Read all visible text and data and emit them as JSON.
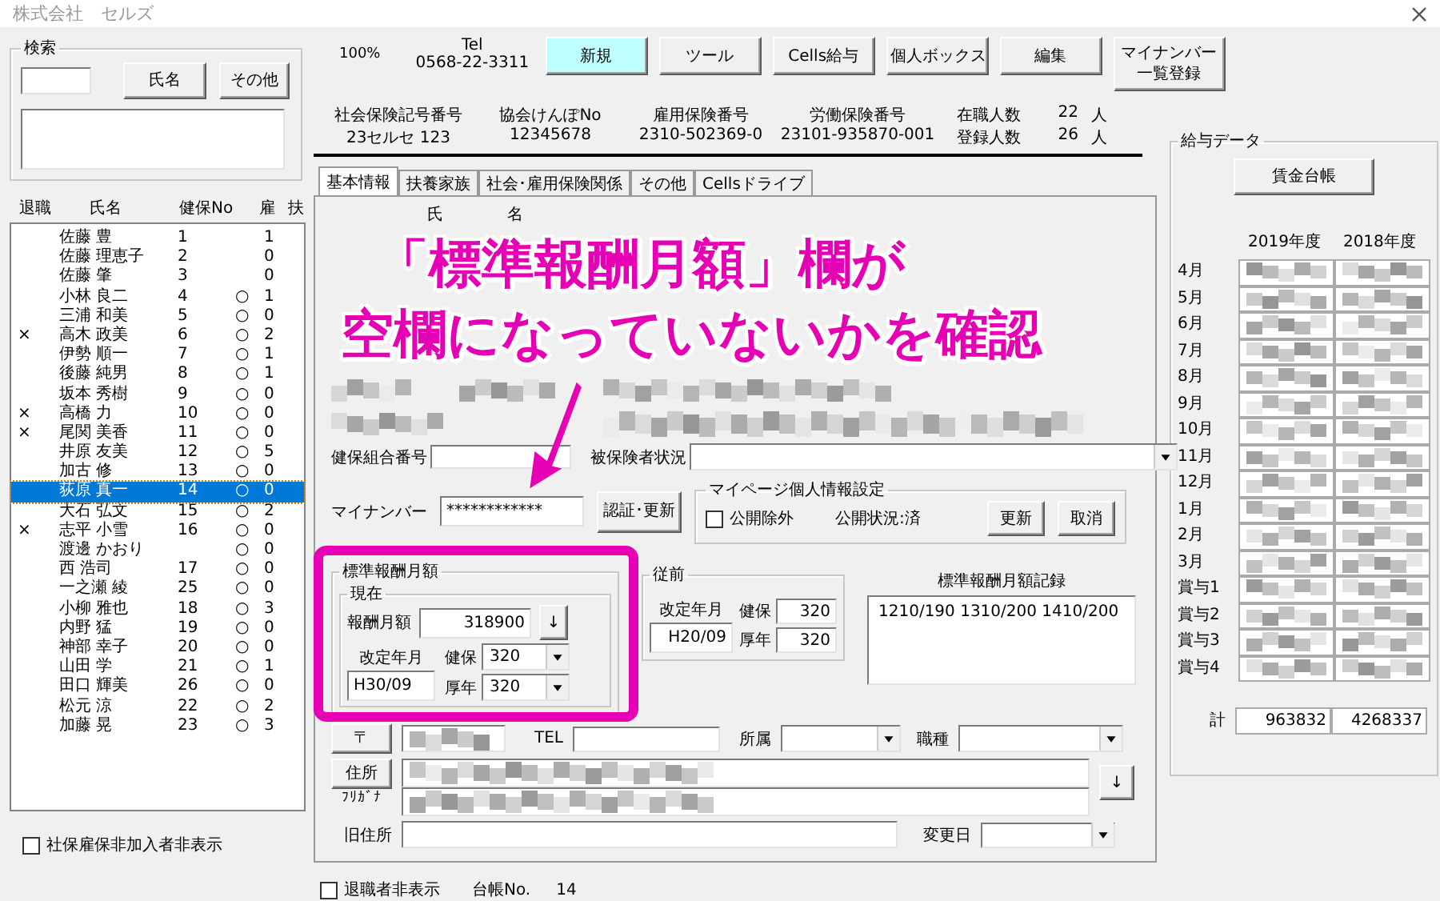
{
  "window": {
    "title": "株式会社　セルズ"
  },
  "search": {
    "label": "検索",
    "buttons": [
      "氏名",
      "その他"
    ]
  },
  "employee_list": {
    "columns": [
      "退職",
      "氏名",
      "健保No",
      "雇",
      "扶"
    ],
    "rows": [
      {
        "name": "佐藤 豊",
        "no": "1",
        "dependents": "1",
        "selected": false
      },
      {
        "name": "佐藤 理恵子",
        "no": "2",
        "dependents": "0",
        "selected": false
      },
      {
        "name": "佐藤 肇",
        "no": "3",
        "dependents": "0",
        "selected": false
      },
      {
        "name": "小林 良二",
        "no": "4",
        "employment": "○",
        "dependents": "1",
        "selected": false
      },
      {
        "name": "三浦 和美",
        "no": "5",
        "employment": "○",
        "dependents": "0",
        "selected": false
      },
      {
        "retired": "×",
        "name": "高木 政美",
        "no": "6",
        "employment": "○",
        "dependents": "2",
        "selected": false
      },
      {
        "name": "伊勢 順一",
        "no": "7",
        "employment": "○",
        "dependents": "1",
        "selected": false
      },
      {
        "name": "後藤 純男",
        "no": "8",
        "employment": "○",
        "dependents": "1",
        "selected": false
      },
      {
        "name": "坂本 秀樹",
        "no": "9",
        "employment": "○",
        "dependents": "0",
        "selected": false
      },
      {
        "retired": "×",
        "name": "高橋 力",
        "no": "10",
        "employment": "○",
        "dependents": "0",
        "selected": false
      },
      {
        "retired": "×",
        "name": "尾関 美香",
        "no": "11",
        "employment": "○",
        "dependents": "0",
        "selected": false
      },
      {
        "name": "井原 友美",
        "no": "12",
        "employment": "○",
        "dependents": "5",
        "selected": false
      },
      {
        "name": "加古 修",
        "no": "13",
        "employment": "○",
        "dependents": "0",
        "selected": false
      },
      {
        "name": "荻原 真一",
        "no": "14",
        "employment": "○",
        "dependents": "0",
        "selected": true
      },
      {
        "name": "大石 弘文",
        "no": "15",
        "employment": "○",
        "dependents": "2",
        "selected": false
      },
      {
        "retired": "×",
        "name": "志平 小雪",
        "no": "16",
        "employment": "○",
        "dependents": "0",
        "selected": false
      },
      {
        "name": "渡邊 かおり",
        "employment": "○",
        "dependents": "0",
        "selected": false
      },
      {
        "name": "西 浩司",
        "no": "17",
        "employment": "○",
        "dependents": "0",
        "selected": false
      },
      {
        "name": "一之瀬 綾",
        "no": "25",
        "employment": "○",
        "dependents": "0",
        "selected": false
      },
      {
        "name": "小柳 雅也",
        "no": "18",
        "employment": "○",
        "dependents": "3",
        "selected": false
      },
      {
        "name": "内野 猛",
        "no": "19",
        "employment": "○",
        "dependents": "0",
        "selected": false
      },
      {
        "name": "神部 幸子",
        "no": "20",
        "employment": "○",
        "dependents": "0",
        "selected": false
      },
      {
        "name": "山田 学",
        "no": "21",
        "employment": "○",
        "dependents": "1",
        "selected": false
      },
      {
        "name": "田口 輝美",
        "no": "26",
        "employment": "○",
        "dependents": "0",
        "selected": false
      },
      {
        "name": "松元 涼",
        "no": "22",
        "employment": "○",
        "dependents": "2",
        "selected": false
      },
      {
        "name": "加藤 晃",
        "no": "23",
        "employment": "○",
        "dependents": "3",
        "selected": false
      }
    ]
  },
  "hide_uninsured": {
    "label": "社保雇保非加入者非表示",
    "checked": false
  },
  "toolbar": {
    "zoom": "100%",
    "tel_label": "Tel",
    "tel": "0568-22-3311",
    "buttons": [
      {
        "label": "新規",
        "highlighted": true
      },
      {
        "label": "ツール",
        "highlighted": false
      },
      {
        "label": "Cells給与",
        "highlighted": false
      },
      {
        "label": "個人ボックス",
        "highlighted": false
      },
      {
        "label": "編集",
        "highlighted": false
      },
      {
        "label": "マイナンバー一覧登録",
        "highlighted": false
      }
    ]
  },
  "company_info": {
    "fields": [
      {
        "label": "社会保険記号番号",
        "value": "23セルセ 123"
      },
      {
        "label": "協会けんぽNo",
        "value": "12345678"
      },
      {
        "label": "雇用保険番号",
        "value": "2310-502369-0"
      },
      {
        "label": "労働保険番号",
        "value": "23101-935870-001"
      }
    ],
    "counts": [
      {
        "label": "在職人数",
        "value": "22",
        "unit": "人"
      },
      {
        "label": "登録人数",
        "value": "26",
        "unit": "人"
      }
    ]
  },
  "tabs": [
    {
      "label": "基本情報",
      "selected": true
    },
    {
      "label": "扶養家族",
      "selected": false
    },
    {
      "label": "社会･雇用保険関係",
      "selected": false
    },
    {
      "label": "その他",
      "selected": false
    },
    {
      "label": "Cellsドライブ",
      "selected": false
    }
  ],
  "basic_info": {
    "name_labels": [
      "氏",
      "名"
    ],
    "union_number_label": "健保組合番号",
    "insured_status_label": "被保険者状況",
    "my_number": {
      "label": "マイナンバー",
      "value": "************",
      "button": "認証･更新"
    },
    "my_page": {
      "title": "マイページ個人情報設定",
      "exclude": {
        "label": "公開除外",
        "checked": false
      },
      "status": "公開状況:済",
      "buttons": [
        "更新",
        "取消"
      ]
    },
    "standard_pay": {
      "title": "標準報酬月額",
      "current": {
        "title": "現在",
        "pay_label": "報酬月額",
        "pay": "318900",
        "arrow": "↓",
        "revision_label": "改定年月",
        "revision": "H30/09",
        "health_label": "健保",
        "health": "320",
        "pension_label": "厚年",
        "pension": "320"
      },
      "previous": {
        "title": "従前",
        "revision_label": "改定年月",
        "revision": "H20/09",
        "health_label": "健保",
        "health": "320",
        "pension_label": "厚年",
        "pension": "320"
      },
      "record": {
        "title": "標準報酬月額記録",
        "value": "1210/190 1310/200 1410/200"
      }
    },
    "address": {
      "postal_button": "〒",
      "tel_label": "TEL",
      "department_label": "所属",
      "job_label": "職種",
      "address_button": "住所",
      "furigana_label": "ﾌﾘｶﾞﾅ",
      "arrow": "↓",
      "old_address_label": "旧住所",
      "change_date_label": "変更日"
    }
  },
  "footer": {
    "hide_retired": {
      "label": "退職者非表示",
      "checked": false
    },
    "ledger_label": "台帳No.",
    "ledger": "14"
  },
  "salary": {
    "title": "給与データ",
    "button": "賃金台帳",
    "years": [
      "2019年度",
      "2018年度"
    ],
    "months": [
      "4月",
      "5月",
      "6月",
      "7月",
      "8月",
      "9月",
      "10月",
      "11月",
      "12月",
      "1月",
      "2月",
      "3月",
      "賞与1",
      "賞与2",
      "賞与3",
      "賞与4"
    ],
    "total_label": "計",
    "totals": [
      "963832",
      "4268337"
    ]
  },
  "annotation": {
    "lines": [
      "「標準報酬月額」欄が",
      "空欄になっていないかを確認"
    ]
  }
}
